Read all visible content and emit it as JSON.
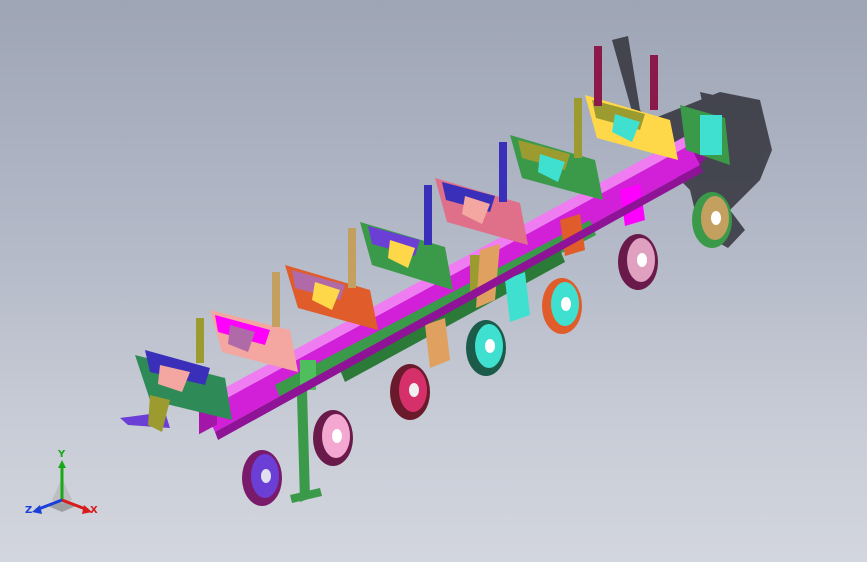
{
  "viewport": {
    "background_top": "#9ea5b5",
    "background_bottom": "#d3d6de"
  },
  "model": {
    "part_colors": [
      "#8b1a4a",
      "#d63aa6",
      "#2e8b57",
      "#ff00ff",
      "#c21bd6",
      "#3fe0d0",
      "#6b3fd6",
      "#f4a7a0",
      "#e05c2a",
      "#ffd84a",
      "#3a2fb8",
      "#9b9b30",
      "#b06aa8",
      "#1c1c9c"
    ],
    "frame_color": "#d21fd8",
    "subframe_color": "#3b9a4a",
    "wheel_tire_color": "#6a1a4a",
    "shadow_color": "#2b2b33"
  },
  "triad": {
    "x_label": "X",
    "y_label": "Y",
    "z_label": "Z",
    "x_color": "#d81b1b",
    "y_color": "#18a818",
    "z_color": "#1b3fd8"
  }
}
